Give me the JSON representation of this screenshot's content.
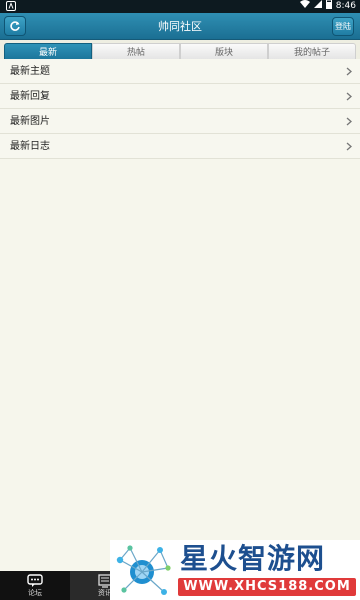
{
  "status_bar": {
    "time": "8:46"
  },
  "header": {
    "title": "帅同社区",
    "login_label": "登陆"
  },
  "tabs": [
    {
      "label": "最新",
      "active": true
    },
    {
      "label": "热帖",
      "active": false
    },
    {
      "label": "版块",
      "active": false
    },
    {
      "label": "我的帖子",
      "active": false
    }
  ],
  "list": [
    {
      "label": "最新主题"
    },
    {
      "label": "最新回复"
    },
    {
      "label": "最新图片"
    },
    {
      "label": "最新日志"
    }
  ],
  "bottom_nav": [
    {
      "label": "论坛",
      "active": true
    },
    {
      "label": "资讯",
      "active": false
    }
  ],
  "watermark": {
    "title": "星火智游网",
    "url": "WWW.XHCS188.COM"
  },
  "colors": {
    "accent": "#1f7ca3",
    "background": "#f6f6ec"
  }
}
